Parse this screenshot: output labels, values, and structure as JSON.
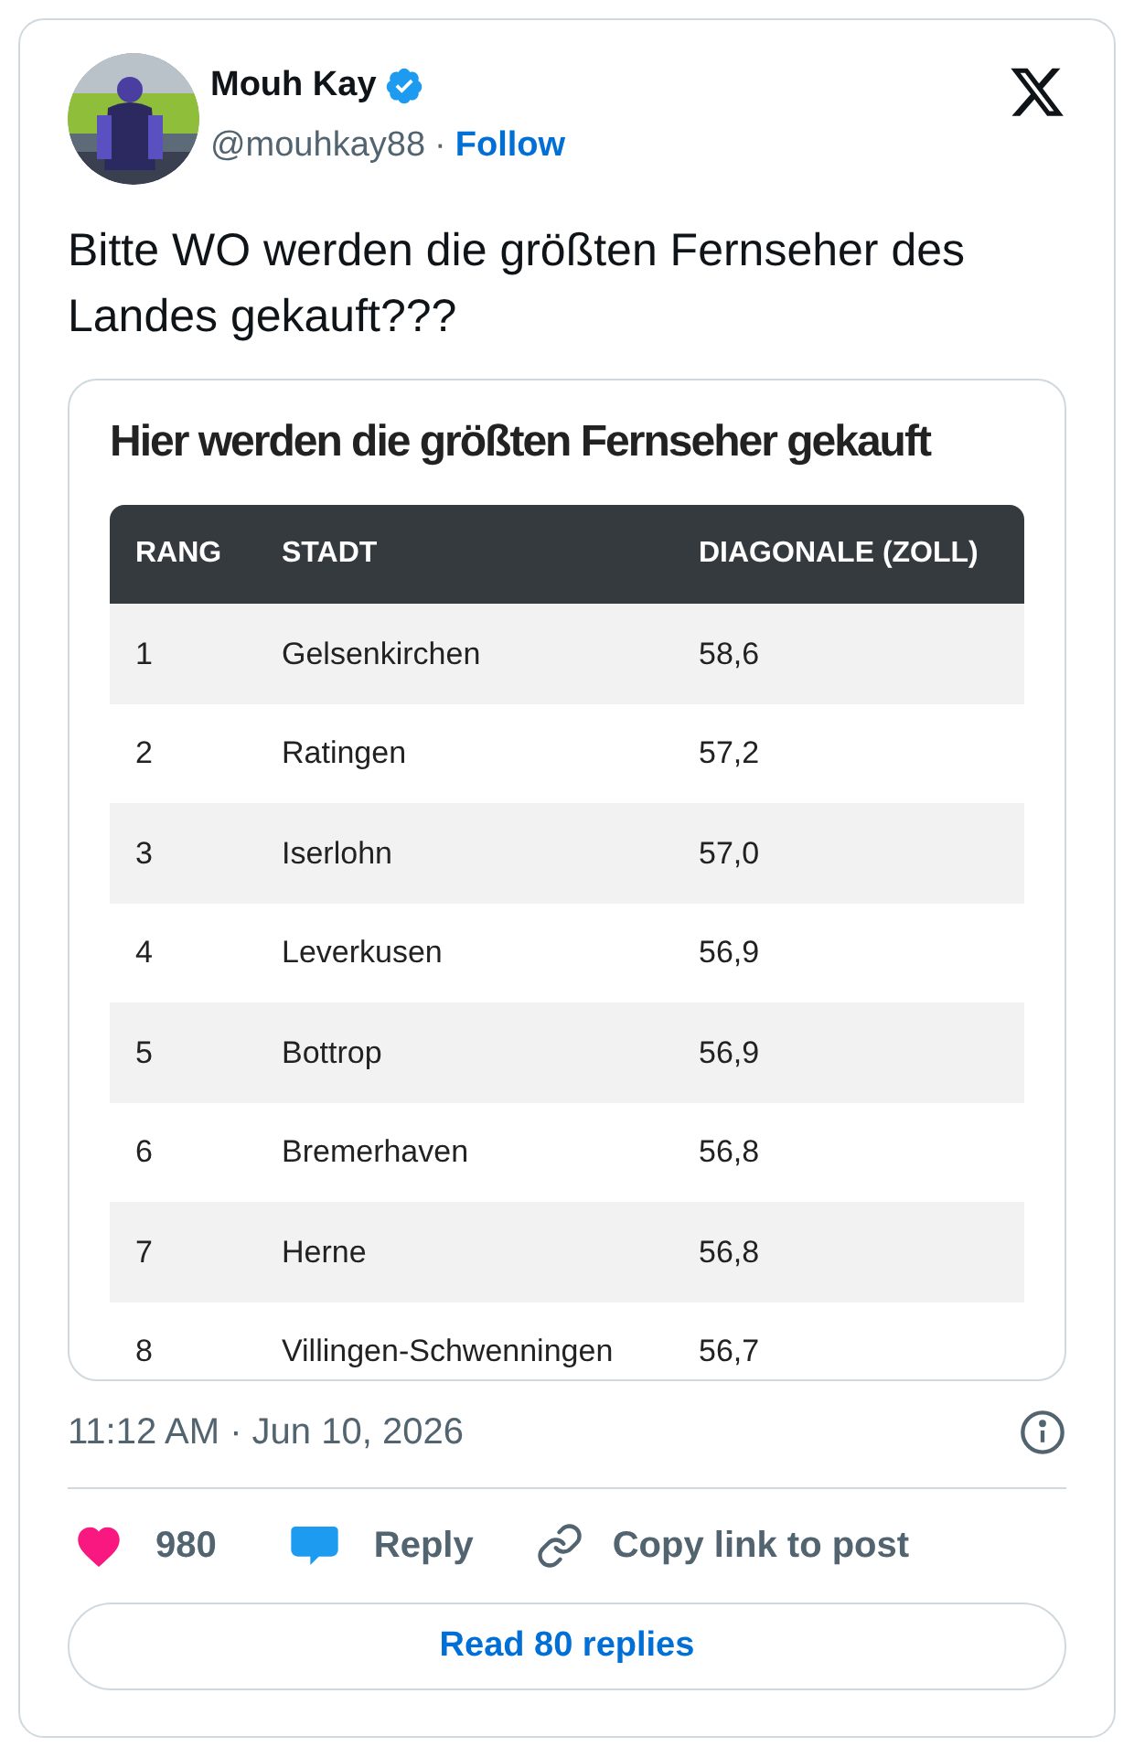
{
  "author": {
    "name": "Mouh Kay",
    "verified": true,
    "handle": "@mouhkay88",
    "separator": "·",
    "follow": "Follow"
  },
  "text": "Bitte WO werden die größten Fernseher des Landes gekauft???",
  "media": {
    "title": "Hier werden die größten Fernseher gekauft",
    "columns": [
      "RANG",
      "STADT",
      "DIAGONALE (ZOLL)"
    ],
    "rows": [
      [
        "1",
        "Gelsenkirchen",
        "58,6"
      ],
      [
        "2",
        "Ratingen",
        "57,2"
      ],
      [
        "3",
        "Iserlohn",
        "57,0"
      ],
      [
        "4",
        "Leverkusen",
        "56,9"
      ],
      [
        "5",
        "Bottrop",
        "56,9"
      ],
      [
        "6",
        "Bremerhaven",
        "56,8"
      ],
      [
        "7",
        "Herne",
        "56,8"
      ],
      [
        "8",
        "Villingen-Schwenningen",
        "56,7"
      ]
    ]
  },
  "timestamp": "11:12 AM · Jun 10, 2026",
  "actions": {
    "likes": "980",
    "reply": "Reply",
    "copy": "Copy link to post"
  },
  "read_replies": "Read 80 replies"
}
